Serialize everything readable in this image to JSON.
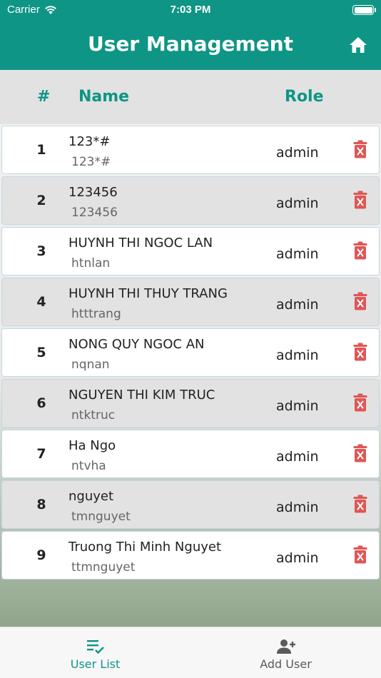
{
  "status_bar": {
    "carrier": "Carrier",
    "time": "7:03 PM"
  },
  "header": {
    "title": "User Management",
    "home_icon": "home-icon"
  },
  "table": {
    "columns": {
      "index": "#",
      "name": "Name",
      "role": "Role"
    },
    "rows": [
      {
        "index": "1",
        "name": "123*#",
        "username": "123*#",
        "role": "admin"
      },
      {
        "index": "2",
        "name": "123456",
        "username": "123456",
        "role": "admin"
      },
      {
        "index": "3",
        "name": "HUYNH THI NGOC LAN",
        "username": "htnlan",
        "role": "admin"
      },
      {
        "index": "4",
        "name": "HUYNH THI THUY TRANG",
        "username": "htttrang",
        "role": "admin"
      },
      {
        "index": "5",
        "name": "NONG QUY NGOC AN",
        "username": "nqnan",
        "role": "admin"
      },
      {
        "index": "6",
        "name": "NGUYEN THI KIM TRUC",
        "username": "ntktruc",
        "role": "admin"
      },
      {
        "index": "7",
        "name": "Ha Ngo",
        "username": "ntvha",
        "role": "admin"
      },
      {
        "index": "8",
        "name": "nguyet",
        "username": "tmnguyet",
        "role": "admin"
      },
      {
        "index": "9",
        "name": "Truong Thi Minh Nguyet",
        "username": "ttmnguyet",
        "role": "admin"
      }
    ],
    "delete_icon": "trash-delete-icon"
  },
  "tab_bar": {
    "tabs": [
      {
        "label": "User List",
        "icon": "list-check-icon",
        "active": true
      },
      {
        "label": "Add User",
        "icon": "add-user-icon",
        "active": false
      }
    ]
  },
  "colors": {
    "primary": "#0e9585",
    "header_row": "#e2e2e2",
    "row_alt": "#e2e2e2",
    "delete": "#e05656",
    "inactive_tab": "#5a5a5a"
  }
}
